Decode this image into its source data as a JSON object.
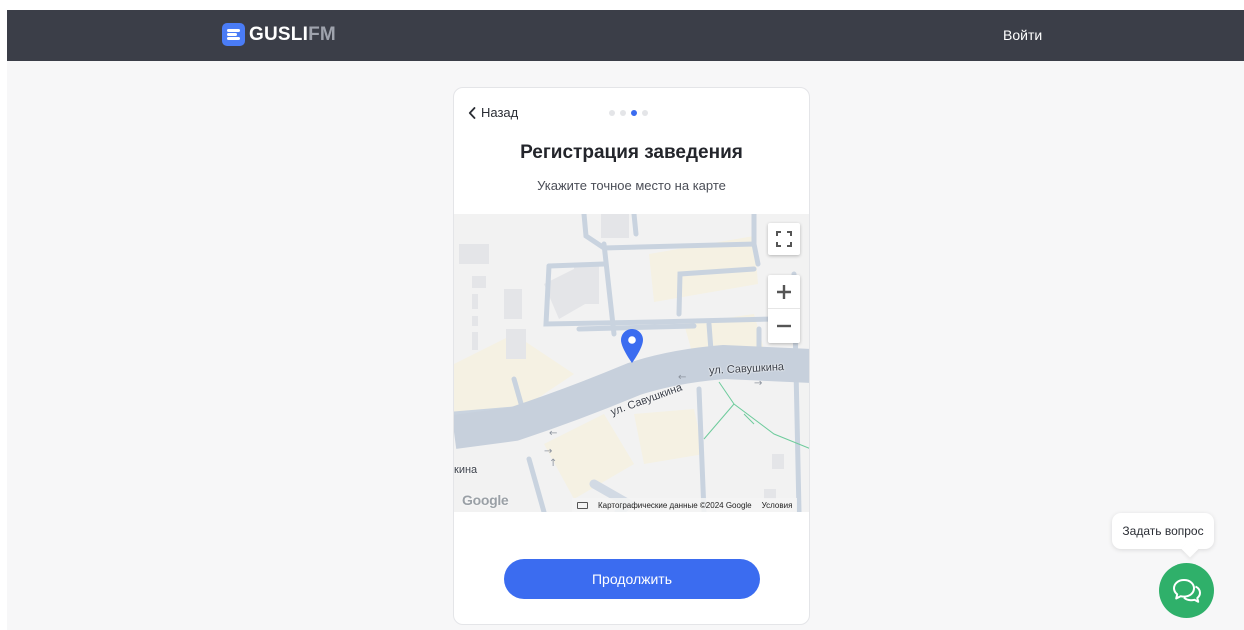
{
  "header": {
    "logo_primary": "GUSLI",
    "logo_secondary": "FM",
    "login_label": "Войти"
  },
  "registration": {
    "back_label": "Назад",
    "steps_total": 4,
    "step_current": 3,
    "title": "Регистрация заведения",
    "subtitle": "Укажите точное место на карте",
    "continue_label": "Продолжить"
  },
  "map": {
    "street_label_1": "ул. Савушкина",
    "street_label_2": "ул. Савушкина",
    "street_label_3": "кина",
    "google_logo": "Google",
    "attribution": "Картографические данные ©2024 Google",
    "terms_label": "Условия",
    "controls": [
      "fullscreen-icon",
      "zoom-in-icon",
      "zoom-out-icon"
    ],
    "pin_color": "#3b6cf0"
  },
  "support": {
    "ask_label": "Задать вопрос",
    "chat_color": "#2fb06a"
  },
  "colors": {
    "accent": "#3b6cf0",
    "header_bg": "#3b3e48",
    "chat": "#2fb06a"
  }
}
